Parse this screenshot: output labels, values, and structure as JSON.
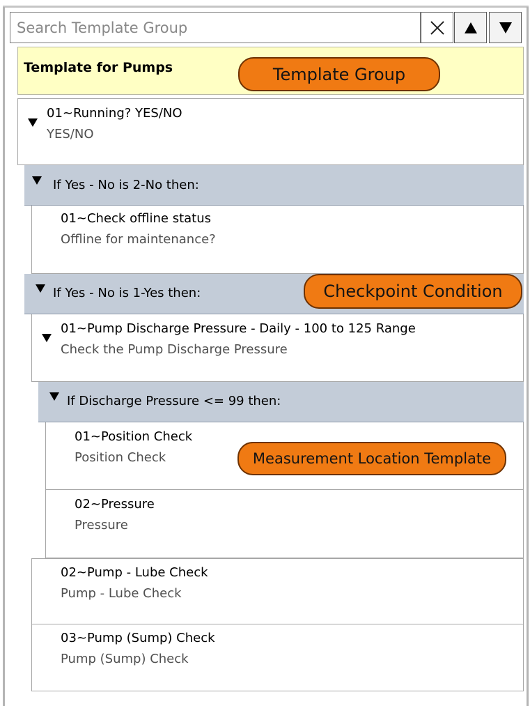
{
  "search": {
    "placeholder": "Search Template Group"
  },
  "controls": {
    "clear": "✕",
    "up": "▲",
    "down": "▼"
  },
  "template_group": {
    "title": "Template for Pumps",
    "callout": "Template Group",
    "background": "#ffffc4"
  },
  "callouts": {
    "accent": "#f07a13",
    "checkpoint_condition": "Checkpoint Condition",
    "measurement_location_template": "Measurement Location Template"
  },
  "tree": {
    "running": {
      "title": "01~Running? YES/NO",
      "subtitle": "YES/NO"
    },
    "cond_no": {
      "label": "If Yes - No is 2-No then:"
    },
    "offline": {
      "title": "01~Check offline status",
      "subtitle": "Offline for maintenance?"
    },
    "cond_yes": {
      "label": "If Yes - No is 1-Yes then:"
    },
    "discharge": {
      "title": "01~Pump Discharge Pressure - Daily - 100 to 125 Range",
      "subtitle": "Check the Pump Discharge Pressure"
    },
    "cond_pressure": {
      "label": "If Discharge Pressure <= 99 then:"
    },
    "position": {
      "title": "01~Position Check",
      "subtitle": "Position Check"
    },
    "pressure": {
      "title": "02~Pressure",
      "subtitle": "Pressure"
    },
    "lube": {
      "title": "02~Pump - Lube Check",
      "subtitle": "Pump - Lube Check"
    },
    "sump": {
      "title": "03~Pump (Sump) Check",
      "subtitle": "Pump (Sump) Check"
    }
  }
}
